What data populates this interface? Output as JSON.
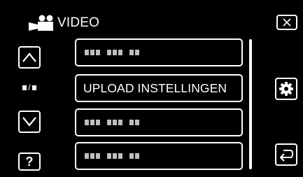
{
  "header": {
    "mode_icon": "video-camera-icon",
    "title": "VIDEO"
  },
  "controls": {
    "close_icon": "close-icon",
    "up_icon": "chevron-up-icon",
    "down_icon": "chevron-down-icon",
    "help_label": "?",
    "page_indicator_slash": "/",
    "gear_icon": "gear-icon",
    "back_icon": "return-arrow-icon"
  },
  "menu": {
    "items": [
      {
        "label": "",
        "obscured": true
      },
      {
        "label": "UPLOAD INSTELLINGEN",
        "obscured": false
      },
      {
        "label": "",
        "obscured": true
      },
      {
        "label": "",
        "obscured": true
      }
    ]
  },
  "colors": {
    "background": "#000000",
    "foreground": "#ffffff",
    "placeholder": "#bfbfbf"
  }
}
